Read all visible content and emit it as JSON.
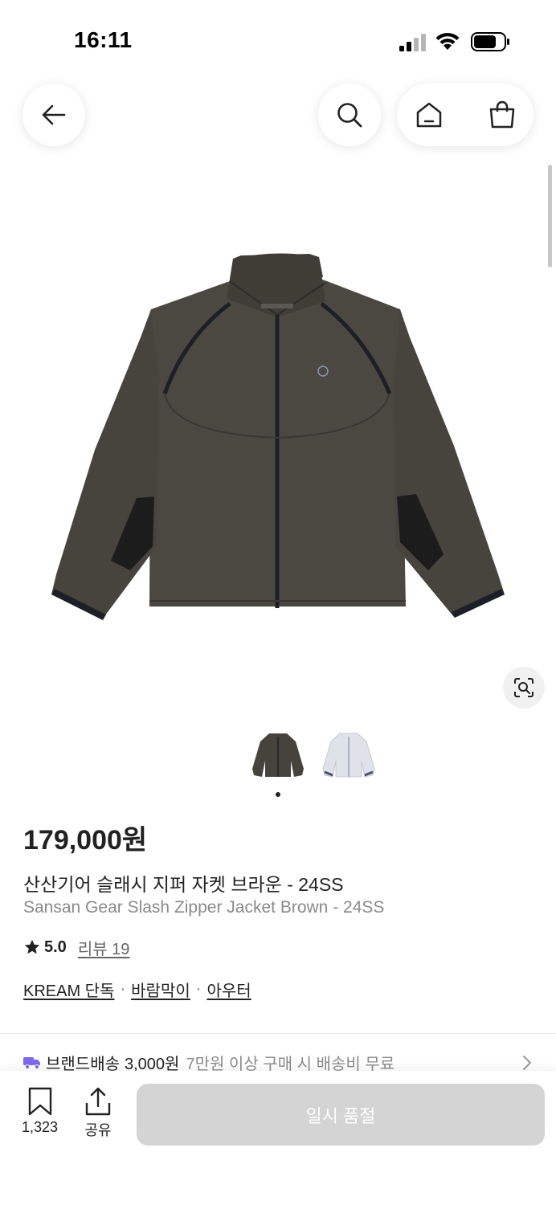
{
  "status_bar": {
    "time": "16:11",
    "icons": [
      "cellular-signal-icon",
      "wifi-icon",
      "battery-icon"
    ]
  },
  "nav": {
    "back_icon": "arrow-left-icon",
    "search_icon": "search-icon",
    "home_icon": "home-icon",
    "cart_icon": "shopping-bag-icon"
  },
  "product": {
    "price": "179,000원",
    "name_ko": "산산기어 슬래시 지퍼 자켓 브라운 - 24SS",
    "name_en": "Sansan Gear Slash Zipper Jacket Brown - 24SS",
    "rating": "5.0",
    "review_label": "리뷰 19",
    "tags": [
      "KREAM 단독",
      "바람막이",
      "아우터"
    ],
    "tag_separator": "·",
    "colors": [
      "brown",
      "light-gray"
    ],
    "image_icon": "lens-search-icon"
  },
  "shipping": {
    "label": "브랜드배송",
    "fee": "3,000원",
    "note": "7만원 이상 구매 시 배송비 무료",
    "icon": "truck-icon",
    "accent": "#7B68EE"
  },
  "bottom_bar": {
    "bookmark_count": "1,323",
    "share_label": "공유",
    "soldout_label": "일시 품절",
    "soldout_bg": "#D4D4D4"
  }
}
